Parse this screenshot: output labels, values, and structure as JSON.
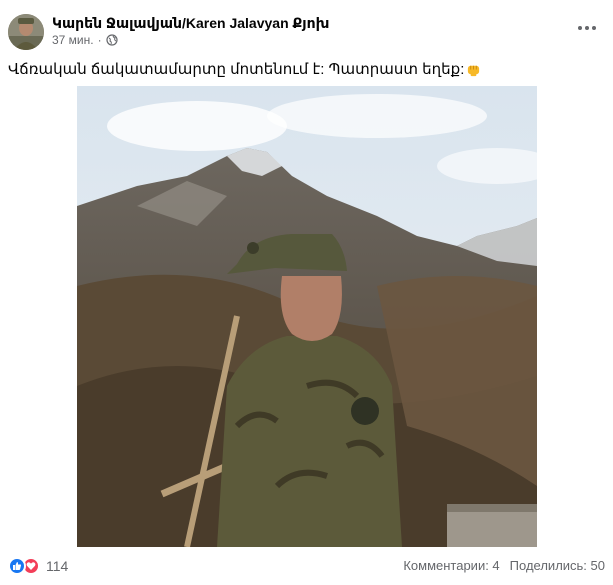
{
  "post": {
    "author": "Կարեն Ջալավյան/Karen Jalavyan Քյոխ",
    "time": "37 мин.",
    "text": "Վճռական ճակատամարտը մոտենում է: Պատրաստ եղեք:",
    "text_emoji": "raised-fist-icon"
  },
  "reactions": {
    "count": "114",
    "types": [
      "like-icon",
      "love-icon"
    ]
  },
  "stats": {
    "comments": "Комментарии: 4",
    "shares": "Поделились: 50"
  },
  "colors": {
    "like": "#1877f2",
    "love": "#f33e58",
    "secondary_text": "#65676b"
  }
}
